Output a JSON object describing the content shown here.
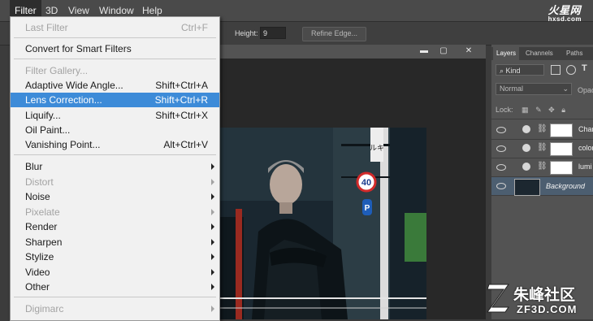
{
  "menubar": {
    "items": [
      "Filter",
      "3D",
      "View",
      "Window",
      "Help"
    ],
    "active": "Filter"
  },
  "top_logo": {
    "brand": "火星网",
    "domain": "hxsd.com"
  },
  "options_bar": {
    "height_label": "Height:",
    "height_value": "9",
    "refine_edge_label": "Refine Edge..."
  },
  "window_controls": [
    "▬",
    "▢",
    "✕"
  ],
  "filter_menu": {
    "last_filter": {
      "label": "Last Filter",
      "shortcut": "Ctrl+F",
      "disabled": true
    },
    "convert_smart": {
      "label": "Convert for Smart Filters"
    },
    "filter_gallery": {
      "label": "Filter Gallery...",
      "disabled": true
    },
    "adaptive_wide": {
      "label": "Adaptive Wide Angle...",
      "shortcut": "Shift+Ctrl+A"
    },
    "lens_correction": {
      "label": "Lens Correction...",
      "shortcut": "Shift+Ctrl+R",
      "highlighted": true
    },
    "liquify": {
      "label": "Liquify...",
      "shortcut": "Shift+Ctrl+X"
    },
    "oil_paint": {
      "label": "Oil Paint..."
    },
    "vanishing_point": {
      "label": "Vanishing Point...",
      "shortcut": "Alt+Ctrl+V"
    },
    "submenus": [
      {
        "label": "Blur",
        "disabled": false
      },
      {
        "label": "Distort",
        "disabled": true
      },
      {
        "label": "Noise",
        "disabled": false
      },
      {
        "label": "Pixelate",
        "disabled": true
      },
      {
        "label": "Render",
        "disabled": false
      },
      {
        "label": "Sharpen",
        "disabled": false
      },
      {
        "label": "Stylize",
        "disabled": false
      },
      {
        "label": "Video",
        "disabled": false
      },
      {
        "label": "Other",
        "disabled": false
      }
    ],
    "digimarc": {
      "label": "Digimarc",
      "disabled": true
    }
  },
  "layers_panel": {
    "tabs": [
      "Layers",
      "Channels",
      "Paths"
    ],
    "active_tab": "Layers",
    "kind_filter": "Kind",
    "blend_mode": "Normal",
    "opacity_label": "Opac",
    "lock_label": "Lock:",
    "layers": [
      {
        "name": "Char",
        "type": "adjustment"
      },
      {
        "name": "color",
        "type": "adjustment"
      },
      {
        "name": "lumi",
        "type": "adjustment"
      },
      {
        "name": "Background",
        "type": "image",
        "selected": true
      }
    ]
  },
  "photo": {
    "sign_speed": "40",
    "sign_parking": "P",
    "sign_vertical": "ルキ"
  },
  "bottom_logo": {
    "brand": "朱峰社区",
    "domain": "ZF3D.COM"
  },
  "colors": {
    "menu_highlight": "#3d8bd8",
    "selected_layer": "#4c5e70",
    "speed_sign_red": "#d22a2a",
    "parking_blue": "#1e5db8"
  }
}
